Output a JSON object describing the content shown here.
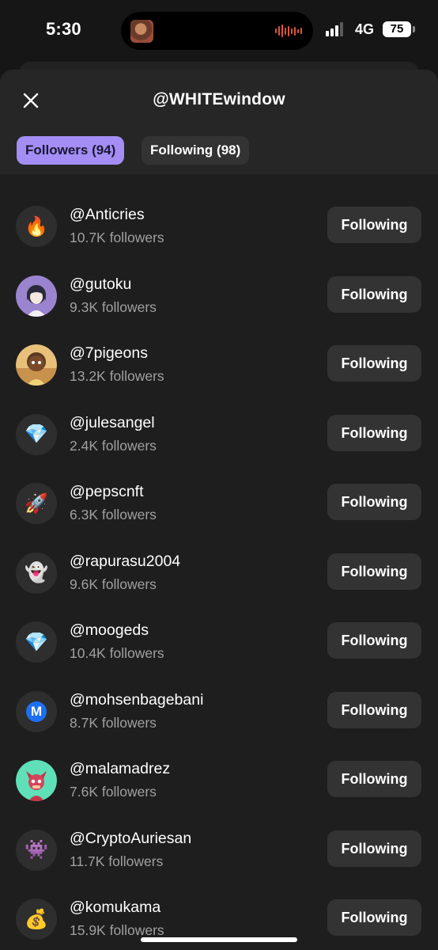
{
  "status_bar": {
    "time": "5:30",
    "network": "4G",
    "battery": "75"
  },
  "header": {
    "title": "@WHITEwindow",
    "tabs": [
      {
        "label": "Followers (94)",
        "active": true
      },
      {
        "label": "Following (98)",
        "active": false
      }
    ]
  },
  "colors": {
    "accent": "#a48ef5",
    "button_bg": "#333333",
    "sheet_bg": "#1e1e1e"
  },
  "users": [
    {
      "handle": "@Anticries",
      "followers": "10.7K followers",
      "button": "Following",
      "avatar_icon": "fire-emoji",
      "avatar_glyph": "🔥"
    },
    {
      "handle": "@gutoku",
      "followers": "9.3K followers",
      "button": "Following",
      "avatar_icon": "anime-girl-avatar",
      "avatar_glyph": ""
    },
    {
      "handle": "@7pigeons",
      "followers": "13.2K followers",
      "button": "Following",
      "avatar_icon": "cartoon-boy-avatar",
      "avatar_glyph": ""
    },
    {
      "handle": "@julesangel",
      "followers": "2.4K followers",
      "button": "Following",
      "avatar_icon": "gem-emoji",
      "avatar_glyph": "💎"
    },
    {
      "handle": "@pepscnft",
      "followers": "6.3K followers",
      "button": "Following",
      "avatar_icon": "rocket-emoji",
      "avatar_glyph": "🚀"
    },
    {
      "handle": "@rapurasu2004",
      "followers": "9.6K followers",
      "button": "Following",
      "avatar_icon": "ghost-emoji",
      "avatar_glyph": "👻"
    },
    {
      "handle": "@moogeds",
      "followers": "10.4K followers",
      "button": "Following",
      "avatar_icon": "gem-emoji",
      "avatar_glyph": "💎"
    },
    {
      "handle": "@mohsenbagebani",
      "followers": "8.7K followers",
      "button": "Following",
      "avatar_icon": "m-logo",
      "avatar_glyph": "M"
    },
    {
      "handle": "@malamadrez",
      "followers": "7.6K followers",
      "button": "Following",
      "avatar_icon": "pink-cat-avatar",
      "avatar_glyph": ""
    },
    {
      "handle": "@CryptoAuriesan",
      "followers": "11.7K followers",
      "button": "Following",
      "avatar_icon": "space-invader-emoji",
      "avatar_glyph": "👾"
    },
    {
      "handle": "@komukama",
      "followers": "15.9K followers",
      "button": "Following",
      "avatar_icon": "money-bag-emoji",
      "avatar_glyph": "💰"
    }
  ]
}
